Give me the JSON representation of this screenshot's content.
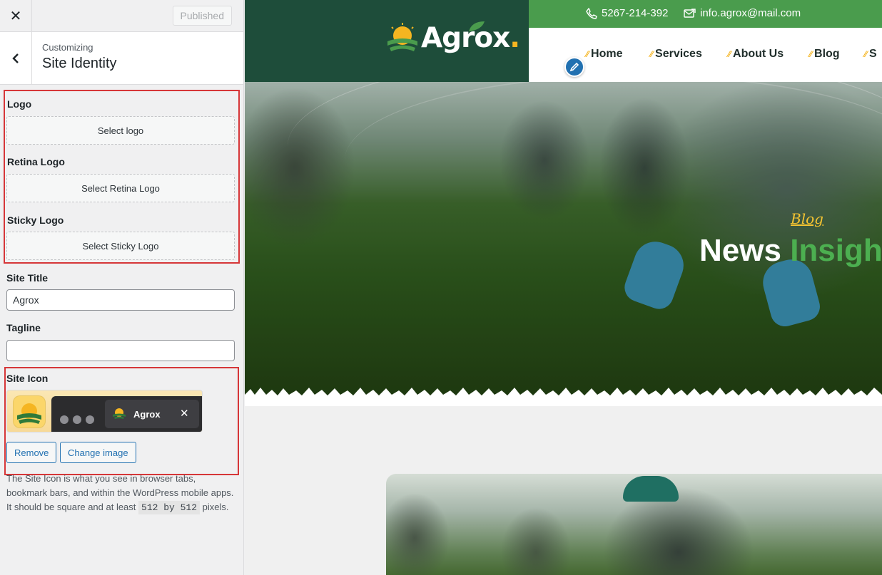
{
  "sidebar": {
    "published_label": "Published",
    "breadcrumb": "Customizing",
    "section_title": "Site Identity",
    "logo": {
      "label": "Logo",
      "button": "Select logo"
    },
    "retina_logo": {
      "label": "Retina Logo",
      "button": "Select Retina Logo"
    },
    "sticky_logo": {
      "label": "Sticky Logo",
      "button": "Select Sticky Logo"
    },
    "site_title": {
      "label": "Site Title",
      "value": "Agrox"
    },
    "tagline": {
      "label": "Tagline",
      "value": ""
    },
    "site_icon": {
      "label": "Site Icon",
      "tab_label": "Agrox",
      "remove_button": "Remove",
      "change_button": "Change image",
      "description_before": "The Site Icon is what you see in browser tabs, bookmark bars, and within the WordPress mobile apps. It should be square and at least",
      "description_code": "512 by 512",
      "description_after": "pixels."
    }
  },
  "preview": {
    "brand": "Agrox",
    "brand_dot": ".",
    "phone": "5267-214-392",
    "email": "info.agrox@mail.com",
    "nav": [
      "Home",
      "Services",
      "About Us",
      "Blog",
      "S"
    ],
    "hero_tag": "Blog",
    "hero_title_main": "News",
    "hero_title_highlight": "Insight"
  },
  "colors": {
    "brand_dark_green": "#1e4d3a",
    "topbar_green": "#4a9c4d",
    "accent_yellow": "#f5b521",
    "wp_blue": "#2271b1",
    "highlight_red": "#d63638"
  },
  "icons": [
    "close-icon",
    "back-chevron-icon",
    "phone-icon",
    "email-icon",
    "pencil-icon",
    "spark-icon"
  ]
}
